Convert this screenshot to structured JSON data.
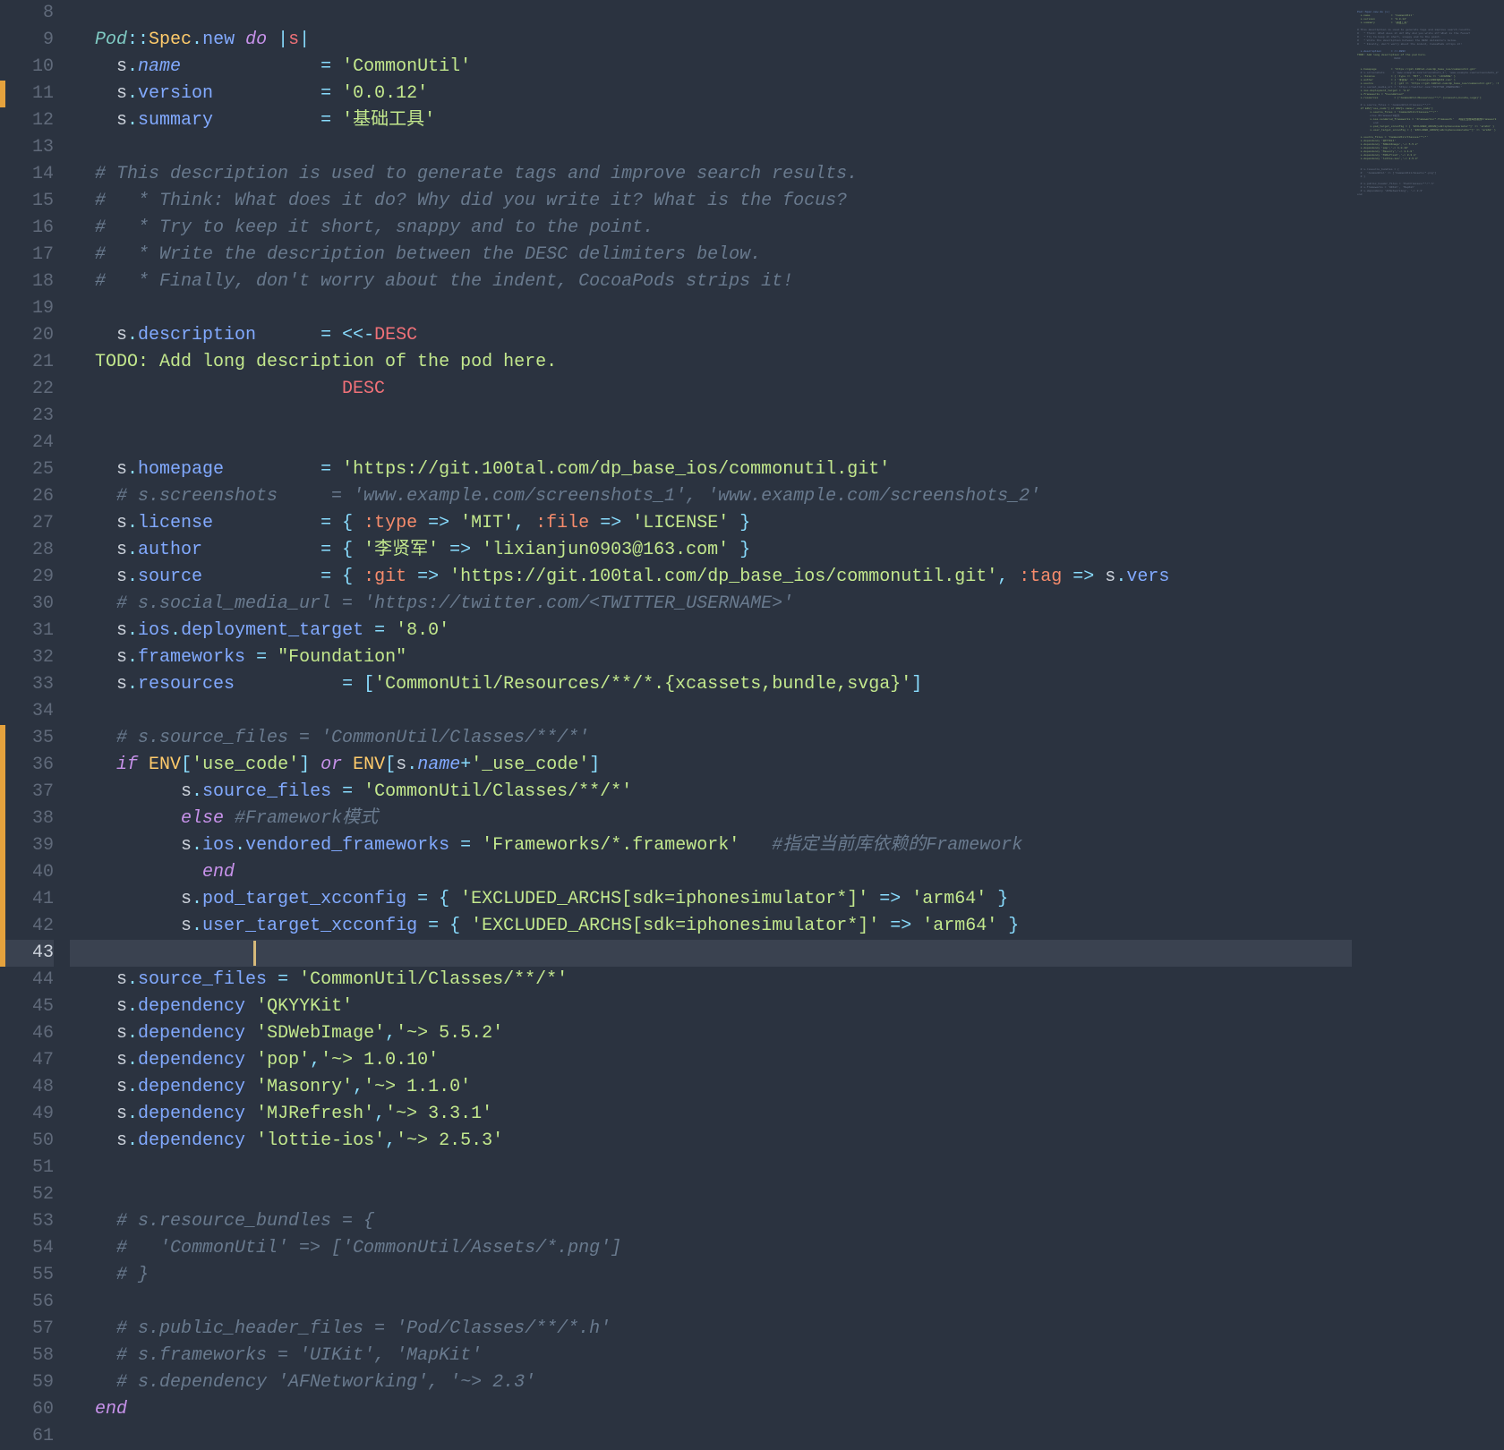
{
  "editor": {
    "first_line_number": 8,
    "current_line": 43,
    "change_markers": [
      11,
      35,
      36,
      37,
      38,
      39,
      40,
      41,
      42,
      43
    ],
    "lines": [
      [],
      [
        {
          "t": "Pod",
          "c": "c-class"
        },
        {
          "t": "::",
          "c": "c-op"
        },
        {
          "t": "Spec",
          "c": "c-const"
        },
        {
          "t": ".",
          "c": "c-op"
        },
        {
          "t": "new",
          "c": "c-method"
        },
        {
          "t": " ",
          "c": ""
        },
        {
          "t": "do",
          "c": "c-keyword"
        },
        {
          "t": " ",
          "c": ""
        },
        {
          "t": "|",
          "c": "c-pipe"
        },
        {
          "t": "s",
          "c": "c-desc"
        },
        {
          "t": "|",
          "c": "c-pipe"
        }
      ],
      [
        {
          "t": "  s",
          "c": "c-var"
        },
        {
          "t": ".",
          "c": "c-op"
        },
        {
          "t": "name",
          "c": "c-name"
        },
        {
          "t": "             ",
          "c": ""
        },
        {
          "t": "=",
          "c": "c-op"
        },
        {
          "t": " ",
          "c": ""
        },
        {
          "t": "'CommonUtil'",
          "c": "c-string"
        }
      ],
      [
        {
          "t": "  s",
          "c": "c-var"
        },
        {
          "t": ".",
          "c": "c-op"
        },
        {
          "t": "version",
          "c": "c-method"
        },
        {
          "t": "          ",
          "c": ""
        },
        {
          "t": "=",
          "c": "c-op"
        },
        {
          "t": " ",
          "c": ""
        },
        {
          "t": "'0.0.12'",
          "c": "c-string"
        }
      ],
      [
        {
          "t": "  s",
          "c": "c-var"
        },
        {
          "t": ".",
          "c": "c-op"
        },
        {
          "t": "summary",
          "c": "c-method"
        },
        {
          "t": "          ",
          "c": ""
        },
        {
          "t": "=",
          "c": "c-op"
        },
        {
          "t": " ",
          "c": ""
        },
        {
          "t": "'基础工具'",
          "c": "c-string"
        }
      ],
      [],
      [
        {
          "t": "# This description is used to generate tags and improve search results.",
          "c": "c-comment"
        }
      ],
      [
        {
          "t": "#   * Think: What does it do? Why did you write it? What is the focus?",
          "c": "c-comment"
        }
      ],
      [
        {
          "t": "#   * Try to keep it short, snappy and to the point.",
          "c": "c-comment"
        }
      ],
      [
        {
          "t": "#   * Write the description between the DESC delimiters below.",
          "c": "c-comment"
        }
      ],
      [
        {
          "t": "#   * Finally, don't worry about the indent, CocoaPods strips it!",
          "c": "c-comment"
        }
      ],
      [],
      [
        {
          "t": "  s",
          "c": "c-var"
        },
        {
          "t": ".",
          "c": "c-op"
        },
        {
          "t": "description",
          "c": "c-method"
        },
        {
          "t": "      ",
          "c": ""
        },
        {
          "t": "=",
          "c": "c-op"
        },
        {
          "t": " ",
          "c": ""
        },
        {
          "t": "<<-",
          "c": "c-op"
        },
        {
          "t": "DESC",
          "c": "c-desc"
        }
      ],
      [
        {
          "t": "TODO: Add long description of the pod here.",
          "c": "c-string"
        }
      ],
      [
        {
          "t": "                       ",
          "c": ""
        },
        {
          "t": "DESC",
          "c": "c-desc"
        }
      ],
      [],
      [],
      [
        {
          "t": "  s",
          "c": "c-var"
        },
        {
          "t": ".",
          "c": "c-op"
        },
        {
          "t": "homepage",
          "c": "c-method"
        },
        {
          "t": "         ",
          "c": ""
        },
        {
          "t": "=",
          "c": "c-op"
        },
        {
          "t": " ",
          "c": ""
        },
        {
          "t": "'https://git.100tal.com/dp_base_ios/commonutil.git'",
          "c": "c-string"
        }
      ],
      [
        {
          "t": "  ",
          "c": ""
        },
        {
          "t": "# s.screenshots     = 'www.example.com/screenshots_1', 'www.example.com/screenshots_2'",
          "c": "c-comment"
        }
      ],
      [
        {
          "t": "  s",
          "c": "c-var"
        },
        {
          "t": ".",
          "c": "c-op"
        },
        {
          "t": "license",
          "c": "c-method"
        },
        {
          "t": "          ",
          "c": ""
        },
        {
          "t": "=",
          "c": "c-op"
        },
        {
          "t": " { ",
          "c": "c-op"
        },
        {
          "t": ":type",
          "c": "c-symbol"
        },
        {
          "t": " => ",
          "c": "c-op"
        },
        {
          "t": "'MIT'",
          "c": "c-string"
        },
        {
          "t": ", ",
          "c": "c-op"
        },
        {
          "t": ":file",
          "c": "c-symbol"
        },
        {
          "t": " => ",
          "c": "c-op"
        },
        {
          "t": "'LICENSE'",
          "c": "c-string"
        },
        {
          "t": " }",
          "c": "c-op"
        }
      ],
      [
        {
          "t": "  s",
          "c": "c-var"
        },
        {
          "t": ".",
          "c": "c-op"
        },
        {
          "t": "author",
          "c": "c-method"
        },
        {
          "t": "           ",
          "c": ""
        },
        {
          "t": "=",
          "c": "c-op"
        },
        {
          "t": " { ",
          "c": "c-op"
        },
        {
          "t": "'李贤军'",
          "c": "c-string"
        },
        {
          "t": " => ",
          "c": "c-op"
        },
        {
          "t": "'lixianjun0903@163.com'",
          "c": "c-string"
        },
        {
          "t": " }",
          "c": "c-op"
        }
      ],
      [
        {
          "t": "  s",
          "c": "c-var"
        },
        {
          "t": ".",
          "c": "c-op"
        },
        {
          "t": "source",
          "c": "c-method"
        },
        {
          "t": "           ",
          "c": ""
        },
        {
          "t": "=",
          "c": "c-op"
        },
        {
          "t": " { ",
          "c": "c-op"
        },
        {
          "t": ":git",
          "c": "c-symbol"
        },
        {
          "t": " => ",
          "c": "c-op"
        },
        {
          "t": "'https://git.100tal.com/dp_base_ios/commonutil.git'",
          "c": "c-string"
        },
        {
          "t": ", ",
          "c": "c-op"
        },
        {
          "t": ":tag",
          "c": "c-symbol"
        },
        {
          "t": " => ",
          "c": "c-op"
        },
        {
          "t": "s",
          "c": "c-var"
        },
        {
          "t": ".",
          "c": "c-op"
        },
        {
          "t": "vers",
          "c": "c-method"
        }
      ],
      [
        {
          "t": "  ",
          "c": ""
        },
        {
          "t": "# s.social_media_url = 'https://twitter.com/<TWITTER_USERNAME>'",
          "c": "c-comment"
        }
      ],
      [
        {
          "t": "  s",
          "c": "c-var"
        },
        {
          "t": ".",
          "c": "c-op"
        },
        {
          "t": "ios",
          "c": "c-method"
        },
        {
          "t": ".",
          "c": "c-op"
        },
        {
          "t": "deployment_target",
          "c": "c-method"
        },
        {
          "t": " ",
          "c": ""
        },
        {
          "t": "=",
          "c": "c-op"
        },
        {
          "t": " ",
          "c": ""
        },
        {
          "t": "'8.0'",
          "c": "c-string"
        }
      ],
      [
        {
          "t": "  s",
          "c": "c-var"
        },
        {
          "t": ".",
          "c": "c-op"
        },
        {
          "t": "frameworks",
          "c": "c-method"
        },
        {
          "t": " ",
          "c": ""
        },
        {
          "t": "=",
          "c": "c-op"
        },
        {
          "t": " ",
          "c": ""
        },
        {
          "t": "\"Foundation\"",
          "c": "c-string"
        }
      ],
      [
        {
          "t": "  s",
          "c": "c-var"
        },
        {
          "t": ".",
          "c": "c-op"
        },
        {
          "t": "resources",
          "c": "c-method"
        },
        {
          "t": "          ",
          "c": ""
        },
        {
          "t": "=",
          "c": "c-op"
        },
        {
          "t": " [",
          "c": "c-op"
        },
        {
          "t": "'CommonUtil/Resources/**/*.{xcassets,bundle,svga}'",
          "c": "c-string"
        },
        {
          "t": "]",
          "c": "c-op"
        }
      ],
      [],
      [
        {
          "t": "  ",
          "c": ""
        },
        {
          "t": "# s.source_files = 'CommonUtil/Classes/**/*'",
          "c": "c-comment"
        }
      ],
      [
        {
          "t": "  ",
          "c": ""
        },
        {
          "t": "if",
          "c": "c-keyword"
        },
        {
          "t": " ",
          "c": ""
        },
        {
          "t": "ENV",
          "c": "c-const"
        },
        {
          "t": "[",
          "c": "c-op"
        },
        {
          "t": "'use_code'",
          "c": "c-string"
        },
        {
          "t": "] ",
          "c": "c-op"
        },
        {
          "t": "or",
          "c": "c-keyword"
        },
        {
          "t": " ",
          "c": ""
        },
        {
          "t": "ENV",
          "c": "c-const"
        },
        {
          "t": "[",
          "c": "c-op"
        },
        {
          "t": "s",
          "c": "c-var"
        },
        {
          "t": ".",
          "c": "c-op"
        },
        {
          "t": "name",
          "c": "c-name"
        },
        {
          "t": "+",
          "c": "c-op"
        },
        {
          "t": "'_use_code'",
          "c": "c-string"
        },
        {
          "t": "]",
          "c": "c-op"
        }
      ],
      [
        {
          "t": "        s",
          "c": "c-var"
        },
        {
          "t": ".",
          "c": "c-op"
        },
        {
          "t": "source_files",
          "c": "c-method"
        },
        {
          "t": " ",
          "c": ""
        },
        {
          "t": "=",
          "c": "c-op"
        },
        {
          "t": " ",
          "c": ""
        },
        {
          "t": "'CommonUtil/Classes/**/*'",
          "c": "c-string"
        }
      ],
      [
        {
          "t": "        ",
          "c": ""
        },
        {
          "t": "else",
          "c": "c-keyword"
        },
        {
          "t": " ",
          "c": ""
        },
        {
          "t": "#Framework模式",
          "c": "c-comment"
        }
      ],
      [
        {
          "t": "        s",
          "c": "c-var"
        },
        {
          "t": ".",
          "c": "c-op"
        },
        {
          "t": "ios",
          "c": "c-method"
        },
        {
          "t": ".",
          "c": "c-op"
        },
        {
          "t": "vendored_frameworks",
          "c": "c-method"
        },
        {
          "t": " ",
          "c": ""
        },
        {
          "t": "=",
          "c": "c-op"
        },
        {
          "t": " ",
          "c": ""
        },
        {
          "t": "'Frameworks/*.framework'",
          "c": "c-string"
        },
        {
          "t": "   ",
          "c": ""
        },
        {
          "t": "#指定当前库依赖的Framework",
          "c": "c-comment"
        }
      ],
      [
        {
          "t": "          ",
          "c": ""
        },
        {
          "t": "end",
          "c": "c-keyword"
        }
      ],
      [
        {
          "t": "        s",
          "c": "c-var"
        },
        {
          "t": ".",
          "c": "c-op"
        },
        {
          "t": "pod_target_xcconfig",
          "c": "c-method"
        },
        {
          "t": " ",
          "c": ""
        },
        {
          "t": "=",
          "c": "c-op"
        },
        {
          "t": " { ",
          "c": "c-op"
        },
        {
          "t": "'EXCLUDED_ARCHS[sdk=iphonesimulator*]'",
          "c": "c-string"
        },
        {
          "t": " => ",
          "c": "c-op"
        },
        {
          "t": "'arm64'",
          "c": "c-string"
        },
        {
          "t": " }",
          "c": "c-op"
        }
      ],
      [
        {
          "t": "        s",
          "c": "c-var"
        },
        {
          "t": ".",
          "c": "c-op"
        },
        {
          "t": "user_target_xcconfig",
          "c": "c-method"
        },
        {
          "t": " ",
          "c": ""
        },
        {
          "t": "=",
          "c": "c-op"
        },
        {
          "t": " { ",
          "c": "c-op"
        },
        {
          "t": "'EXCLUDED_ARCHS[sdk=iphonesimulator*]'",
          "c": "c-string"
        },
        {
          "t": " => ",
          "c": "c-op"
        },
        {
          "t": "'arm64'",
          "c": "c-string"
        },
        {
          "t": " }",
          "c": "c-op"
        }
      ],
      [
        {
          "t": "        ",
          "c": ""
        }
      ],
      [
        {
          "t": "  s",
          "c": "c-var"
        },
        {
          "t": ".",
          "c": "c-op"
        },
        {
          "t": "source_files",
          "c": "c-method"
        },
        {
          "t": " ",
          "c": ""
        },
        {
          "t": "=",
          "c": "c-op"
        },
        {
          "t": " ",
          "c": ""
        },
        {
          "t": "'CommonUtil/Classes/**/*'",
          "c": "c-string"
        }
      ],
      [
        {
          "t": "  s",
          "c": "c-var"
        },
        {
          "t": ".",
          "c": "c-op"
        },
        {
          "t": "dependency",
          "c": "c-method"
        },
        {
          "t": " ",
          "c": ""
        },
        {
          "t": "'QKYYKit'",
          "c": "c-string"
        }
      ],
      [
        {
          "t": "  s",
          "c": "c-var"
        },
        {
          "t": ".",
          "c": "c-op"
        },
        {
          "t": "dependency",
          "c": "c-method"
        },
        {
          "t": " ",
          "c": ""
        },
        {
          "t": "'SDWebImage'",
          "c": "c-string"
        },
        {
          "t": ",",
          "c": "c-op"
        },
        {
          "t": "'~> 5.5.2'",
          "c": "c-string"
        }
      ],
      [
        {
          "t": "  s",
          "c": "c-var"
        },
        {
          "t": ".",
          "c": "c-op"
        },
        {
          "t": "dependency",
          "c": "c-method"
        },
        {
          "t": " ",
          "c": ""
        },
        {
          "t": "'pop'",
          "c": "c-string"
        },
        {
          "t": ",",
          "c": "c-op"
        },
        {
          "t": "'~> 1.0.10'",
          "c": "c-string"
        }
      ],
      [
        {
          "t": "  s",
          "c": "c-var"
        },
        {
          "t": ".",
          "c": "c-op"
        },
        {
          "t": "dependency",
          "c": "c-method"
        },
        {
          "t": " ",
          "c": ""
        },
        {
          "t": "'Masonry'",
          "c": "c-string"
        },
        {
          "t": ",",
          "c": "c-op"
        },
        {
          "t": "'~> 1.1.0'",
          "c": "c-string"
        }
      ],
      [
        {
          "t": "  s",
          "c": "c-var"
        },
        {
          "t": ".",
          "c": "c-op"
        },
        {
          "t": "dependency",
          "c": "c-method"
        },
        {
          "t": " ",
          "c": ""
        },
        {
          "t": "'MJRefresh'",
          "c": "c-string"
        },
        {
          "t": ",",
          "c": "c-op"
        },
        {
          "t": "'~> 3.3.1'",
          "c": "c-string"
        }
      ],
      [
        {
          "t": "  s",
          "c": "c-var"
        },
        {
          "t": ".",
          "c": "c-op"
        },
        {
          "t": "dependency",
          "c": "c-method"
        },
        {
          "t": " ",
          "c": ""
        },
        {
          "t": "'lottie-ios'",
          "c": "c-string"
        },
        {
          "t": ",",
          "c": "c-op"
        },
        {
          "t": "'~> 2.5.3'",
          "c": "c-string"
        }
      ],
      [],
      [],
      [
        {
          "t": "  ",
          "c": ""
        },
        {
          "t": "# s.resource_bundles = {",
          "c": "c-comment"
        }
      ],
      [
        {
          "t": "  ",
          "c": ""
        },
        {
          "t": "#   'CommonUtil' => ['CommonUtil/Assets/*.png']",
          "c": "c-comment"
        }
      ],
      [
        {
          "t": "  ",
          "c": ""
        },
        {
          "t": "# }",
          "c": "c-comment"
        }
      ],
      [],
      [
        {
          "t": "  ",
          "c": ""
        },
        {
          "t": "# s.public_header_files = 'Pod/Classes/**/*.h'",
          "c": "c-comment"
        }
      ],
      [
        {
          "t": "  ",
          "c": ""
        },
        {
          "t": "# s.frameworks = 'UIKit', 'MapKit'",
          "c": "c-comment"
        }
      ],
      [
        {
          "t": "  ",
          "c": ""
        },
        {
          "t": "# s.dependency 'AFNetworking', '~> 2.3'",
          "c": "c-comment"
        }
      ],
      [
        {
          "t": "end",
          "c": "c-keyword"
        }
      ],
      []
    ]
  }
}
